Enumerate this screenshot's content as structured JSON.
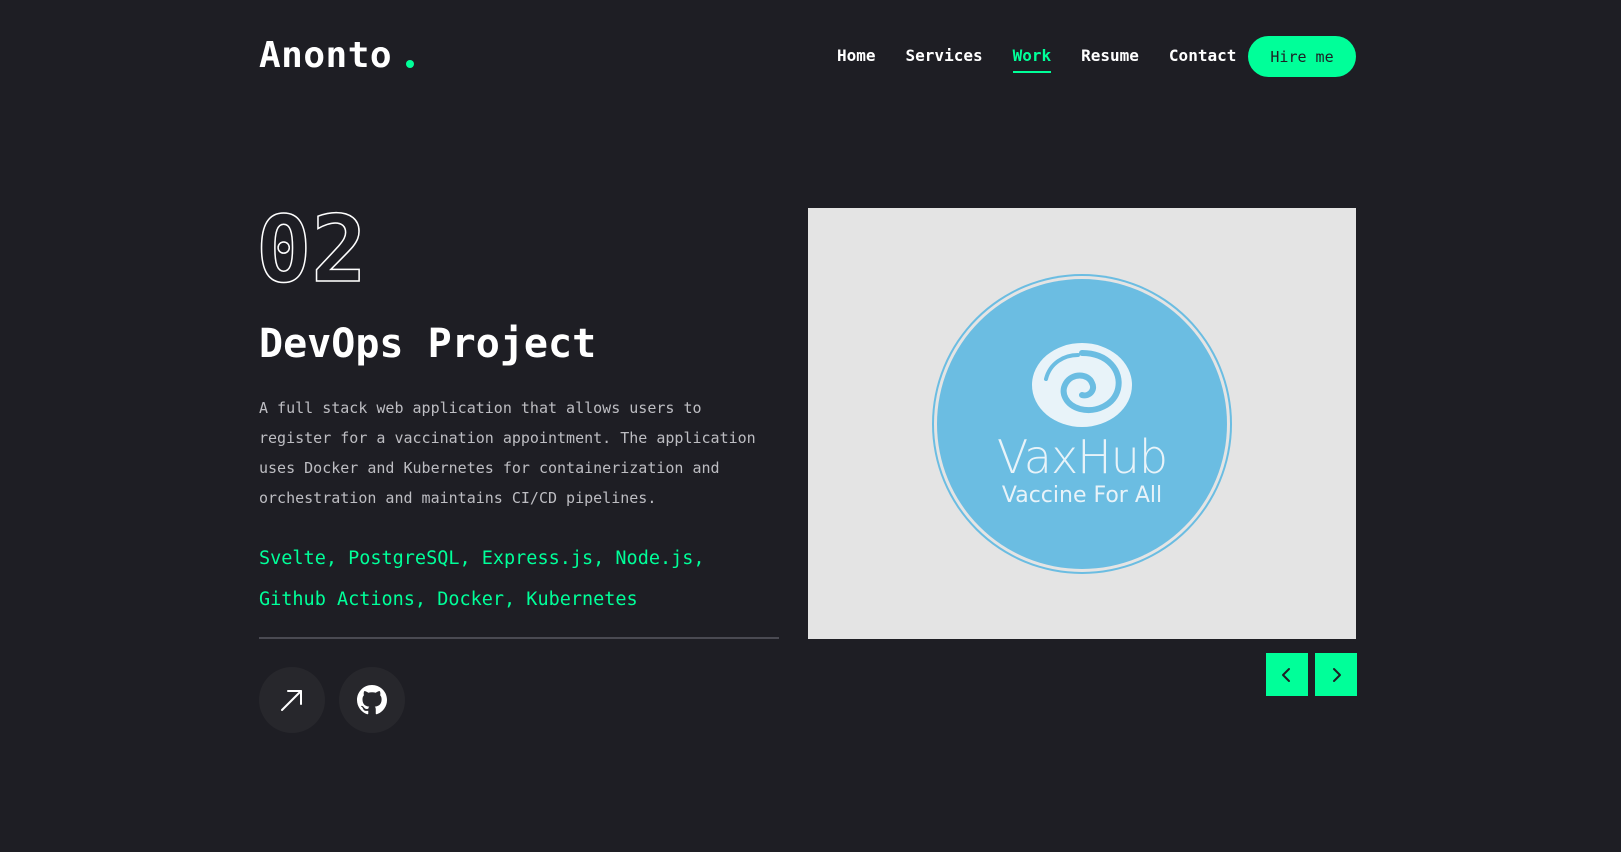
{
  "header": {
    "logo": "Anonto",
    "nav": [
      {
        "label": "Home",
        "active": false
      },
      {
        "label": "Services",
        "active": false
      },
      {
        "label": "Work",
        "active": true
      },
      {
        "label": "Resume",
        "active": false
      },
      {
        "label": "Contact",
        "active": false
      }
    ],
    "hire_label": "Hire me"
  },
  "project": {
    "number": "02",
    "title": "DevOps Project",
    "description": "A full stack web application that allows users to register for a vaccination appointment. The application uses Docker and Kubernetes for containerization and orchestration and maintains CI/CD pipelines.",
    "stack": "Svelte, PostgreSQL, Express.js, Node.js, Github Actions, Docker, Kubernetes",
    "live_icon": "arrow-up-right-icon",
    "github_icon": "github-icon"
  },
  "image": {
    "brand": "VaxHub",
    "tagline": "Vaccine For All"
  },
  "slider": {
    "prev_icon": "chevron-left-icon",
    "next_icon": "chevron-right-icon"
  },
  "colors": {
    "background": "#1e1e24",
    "accent": "#00ff99",
    "badge": "#6bbde2",
    "image_bg": "#e4e4e4"
  }
}
